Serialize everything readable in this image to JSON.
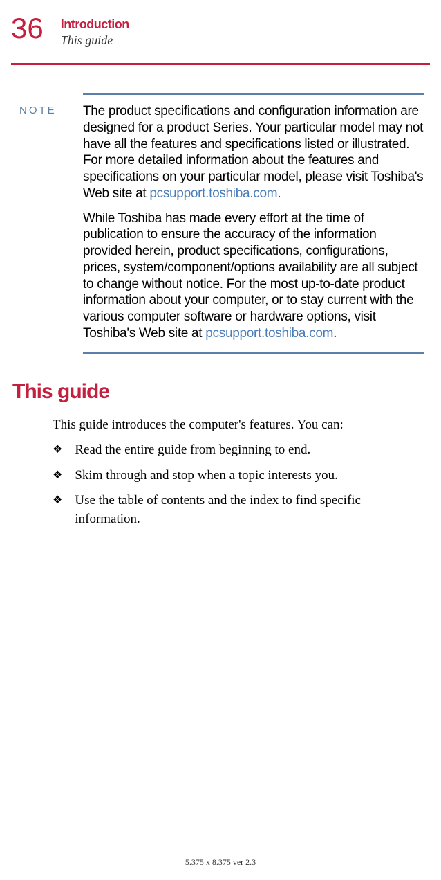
{
  "page_number": "36",
  "chapter_title": "Introduction",
  "section_subtitle": "This guide",
  "note": {
    "label": "NOTE",
    "para1_pre": "The product specifications and configuration information are designed for a product Series. Your particular model may not have all the features and specifications listed or illustrated. For more detailed information about the features and specifications on your particular model, please visit Toshiba's Web site at ",
    "para1_link": "pcsupport.toshiba.com",
    "para1_post": ".",
    "para2_pre": "While Toshiba has made every effort at the time of publication to ensure the accuracy of the information provided herein, product specifications, configurations, prices, system/component/options availability are all subject to change without notice. For the most up-to-date product information about your computer, or to stay current with the various computer software or hardware options, visit Toshiba's Web site at ",
    "para2_link": "pcsupport.toshiba.com",
    "para2_post": "."
  },
  "section_heading": "This guide",
  "intro": "This guide introduces the computer's features. You can:",
  "bullets": [
    "Read the entire guide from beginning to end.",
    "Skim through and stop when a topic interests you.",
    "Use the table of contents and the index to find specific information."
  ],
  "bullet_marker": "❖",
  "footer": "5.375 x 8.375 ver 2.3"
}
